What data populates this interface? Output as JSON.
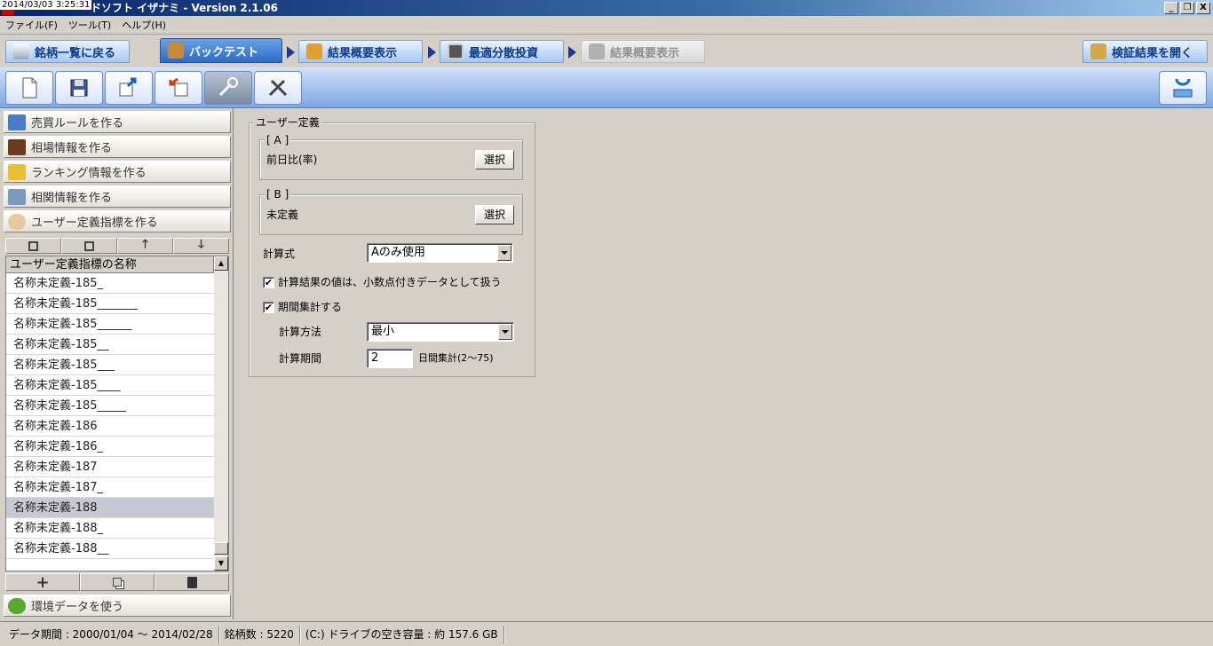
{
  "window": {
    "timestamp": "2014/03/03 3:25:31",
    "title": "ドソフト イザナミ - Version 2.1.06",
    "minimize": "_",
    "restore": "❐",
    "close": "X"
  },
  "menu": [
    "ファイル(F)",
    "ツール(T)",
    "ヘルプ(H)"
  ],
  "tabs": {
    "back_to_list": "銘柄一覧に戻る",
    "backtest": "バックテスト",
    "result_summary": "結果概要表示",
    "optimal_portfolio": "最適分散投資",
    "result_summary_2": "結果概要表示",
    "open_results": "検証結果を開く"
  },
  "nav": {
    "trade_rule": "売買ルールを作る",
    "market_info": "相場情報を作る",
    "ranking_info": "ランキング情報を作る",
    "correlation_info": "相関情報を作る",
    "user_indicator": "ユーザー定義指標を作る",
    "env_data": "環境データを使う"
  },
  "list": {
    "header": "ユーザー定義指標の名称",
    "items": [
      "名称未定義-185_",
      "名称未定義-185_______",
      "名称未定義-185______",
      "名称未定義-185__",
      "名称未定義-185___",
      "名称未定義-185____",
      "名称未定義-185_____",
      "名称未定義-186",
      "名称未定義-186_",
      "名称未定義-187",
      "名称未定義-187_",
      "名称未定義-188",
      "名称未定義-188_",
      "名称未定義-188__"
    ],
    "selected_index": 11
  },
  "form": {
    "group_title": "ユーザー定義",
    "a_label": "[ A ]",
    "a_value": "前日比(率)",
    "b_label": "[ B ]",
    "b_value": "未定義",
    "select_button": "選択",
    "formula_label": "計算式",
    "formula_value": "Aのみ使用",
    "decimal_checkbox": "計算結果の値は、小数点付きデータとして扱う",
    "decimal_checked": true,
    "period_checkbox": "期間集計する",
    "period_checked": true,
    "method_label": "計算方法",
    "method_value": "最小",
    "period_label": "計算期間",
    "period_value": "2",
    "period_unit": "日間集計(2〜75)",
    "check_mark": "✔"
  },
  "status": {
    "data_period": "データ期間 : 2000/01/04 〜 2014/02/28",
    "stock_count": "銘柄数 : 5220",
    "disk_space": "(C:) ドライブの空き容量 : 約 157.6 GB"
  },
  "icons": {
    "plus": "+",
    "trash": "🗑",
    "up": "🡑",
    "down": "🡓",
    "scroll_up": "▲",
    "scroll_down": "▼"
  }
}
